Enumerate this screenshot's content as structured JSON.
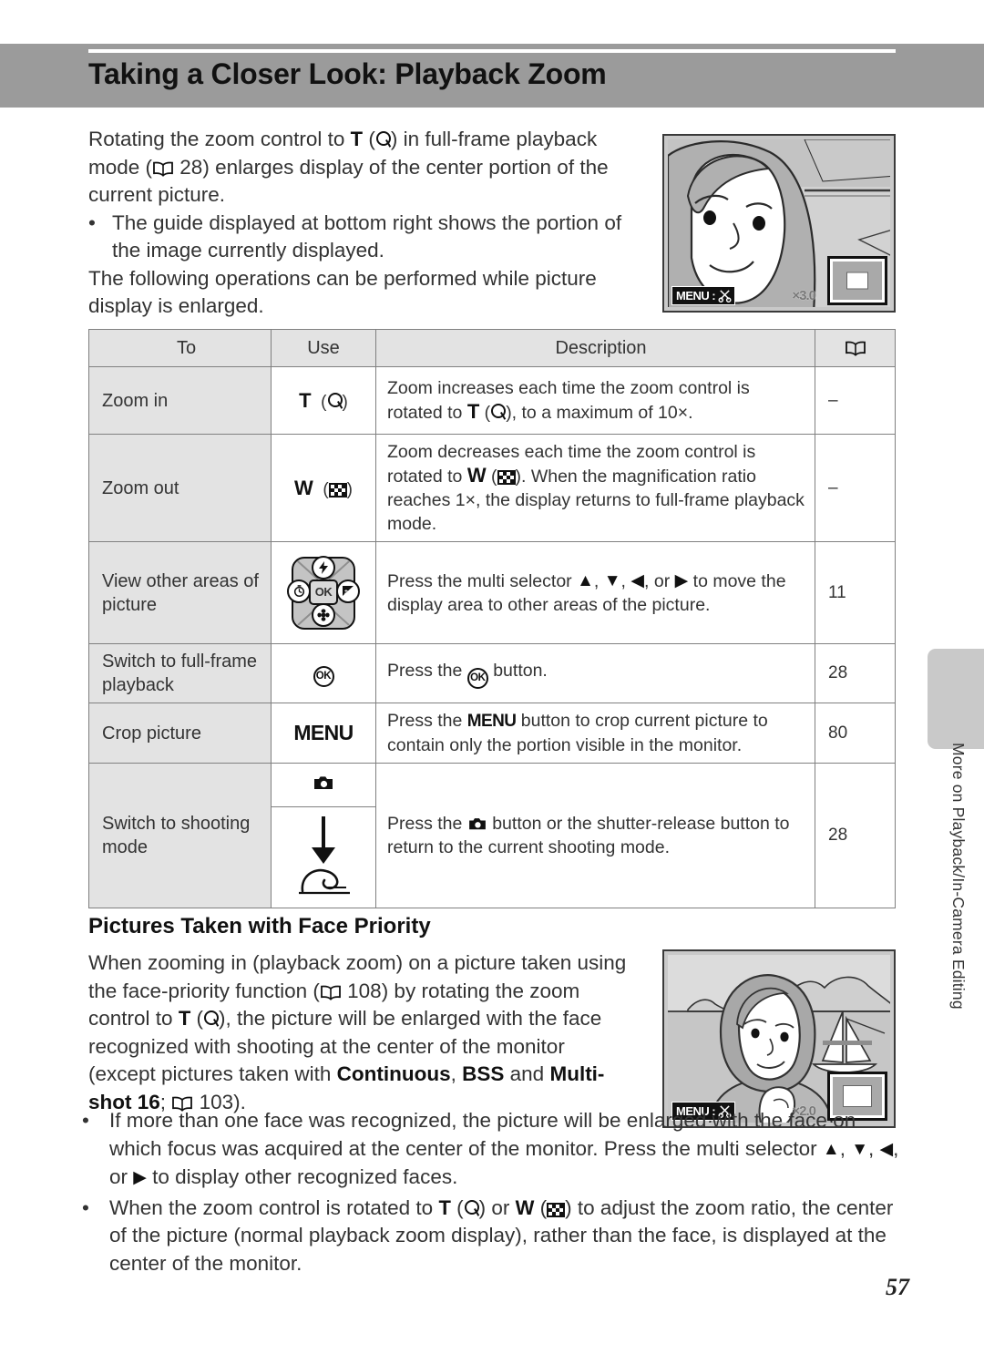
{
  "page": {
    "title": "Taking a Closer Look: Playback Zoom",
    "page_number": "57",
    "side_tab_label": "More on Playback/In-Camera Editing"
  },
  "intro": {
    "p1_a": "Rotating the zoom control to ",
    "p1_T": "T",
    "p1_b": " (",
    "p1_c": ") in full-frame playback mode (",
    "p1_ref": "28",
    "p1_d": ") enlarges display of the center portion of the current picture.",
    "bullet1": "The guide displayed at bottom right shows the portion of the image currently displayed.",
    "p2": "The following operations can be performed while picture display is enlarged."
  },
  "screenshot_top": {
    "menu_label": "MENU",
    "menu_sep": ":",
    "scissors_icon": "scissors-icon",
    "zoom_ratio": "×3.0",
    "guide_icon": "playback-zoom-guide"
  },
  "screenshot_bottom": {
    "menu_label": "MENU",
    "menu_sep": ":",
    "scissors_icon": "scissors-icon",
    "zoom_ratio": "×2.0",
    "guide_icon": "playback-zoom-guide"
  },
  "table": {
    "headers": {
      "to": "To",
      "use": "Use",
      "description": "Description",
      "reference": "book-icon"
    },
    "rows": [
      {
        "to": "Zoom in",
        "use_text": "T",
        "use_icon": "magnifier-icon",
        "desc_a": "Zoom increases each time the zoom control is rotated to ",
        "desc_T": "T",
        "desc_b": " (",
        "desc_c": "), to a maximum of 10×.",
        "ref": "–"
      },
      {
        "to": "Zoom out",
        "use_text": "W",
        "use_icon": "thumbnail-icon",
        "desc_a": "Zoom decreases each time the zoom control is rotated to ",
        "desc_W": "W",
        "desc_b": " (",
        "desc_c": "). When the magnification ratio reaches 1×, the display returns to full-frame playback mode.",
        "ref": "–"
      },
      {
        "to": "View other areas of picture",
        "use_icon": "multi-selector-icon",
        "desc_a": "Press the multi selector ",
        "desc_b": ", ",
        "desc_c": ", ",
        "desc_d": ", or ",
        "desc_e": " to move the display area to other areas of the picture.",
        "ref": "11"
      },
      {
        "to": "Switch to full-frame playback",
        "use_icon": "ok-button-icon",
        "desc_a": "Press the ",
        "desc_b": " button.",
        "ref": "28"
      },
      {
        "to": "Crop picture",
        "use_text": "MENU",
        "desc_a": "Press the ",
        "desc_menu": "MENU",
        "desc_b": " button to crop current picture to contain only the portion visible in the monitor.",
        "ref": "80"
      },
      {
        "to": "Switch to shooting mode",
        "use_icon_top": "camera-button-icon",
        "use_icon_bottom": "shutter-release-icon",
        "desc_a": "Press the ",
        "desc_b": " button or the shutter-release button to return to the current shooting mode.",
        "ref": "28"
      }
    ]
  },
  "face_priority": {
    "heading": "Pictures Taken with Face Priority",
    "p_a": "When zooming in (playback zoom) on a picture taken using the face-priority function (",
    "p_ref1": "108",
    "p_b": ") by rotating the zoom control to ",
    "p_T": "T",
    "p_c": " (",
    "p_d": "), the picture will be enlarged with the face recognized with shooting at the center of the monitor (except pictures taken with ",
    "p_kw1": "Continuous",
    "p_e": ", ",
    "p_kw2": "BSS",
    "p_f": " and ",
    "p_kw3": "Multi-shot 16",
    "p_g": "; ",
    "p_ref2": "103",
    "p_h": ")."
  },
  "tail_bullets": {
    "b1_a": "If more than one face was recognized, the picture will be enlarged with the face on which focus was acquired at the center of the monitor. Press the multi selector ",
    "b1_b": ", ",
    "b1_c": ", ",
    "b1_d": ", or ",
    "b1_e": " to display other recognized faces.",
    "b2_a": "When the zoom control is rotated to ",
    "b2_T": "T",
    "b2_b": " (",
    "b2_c": ") or ",
    "b2_W": "W",
    "b2_d": " (",
    "b2_e": ") to adjust the zoom ratio, the center of the picture (normal playback zoom display), rather than the face, is displayed at the center of the monitor."
  },
  "colors": {
    "header_band": "#9b9b9b",
    "table_head": "#e3e3e3",
    "table_border": "#808080",
    "side_tab": "#c9c9c9"
  }
}
